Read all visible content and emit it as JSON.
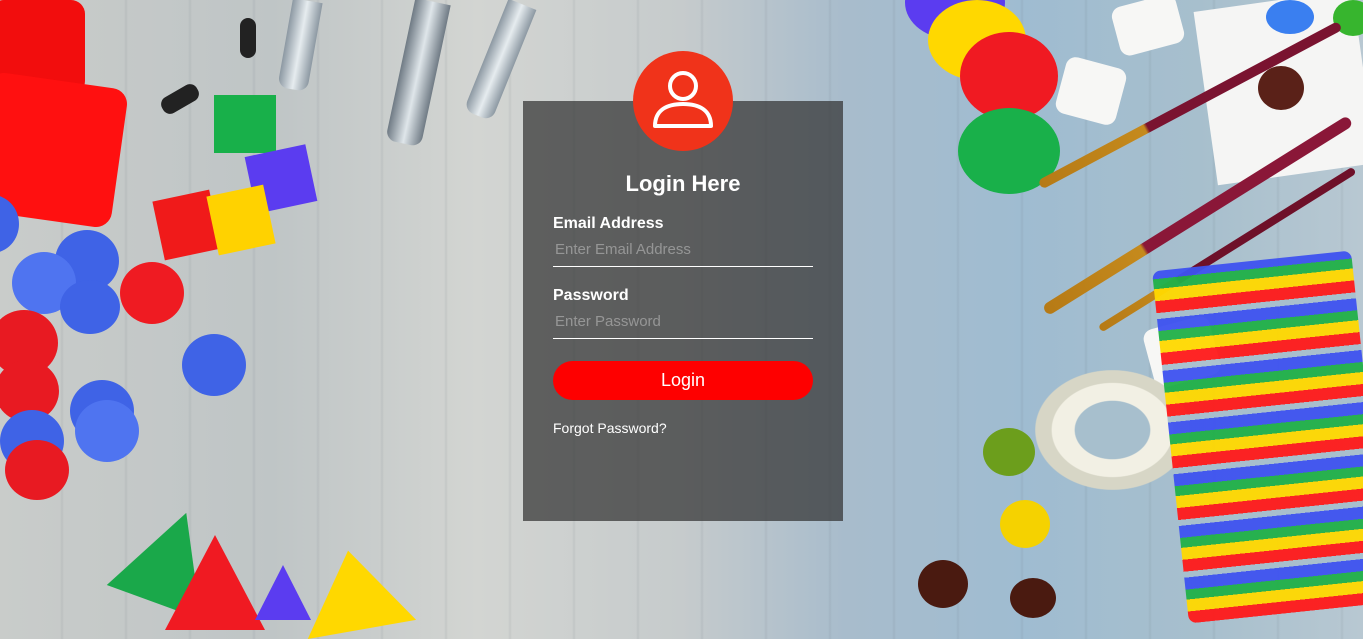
{
  "login": {
    "title": "Login Here",
    "email_label": "Email Address",
    "email_placeholder": "Enter Email Address",
    "password_label": "Password",
    "password_placeholder": "Enter Password",
    "submit_label": "Login",
    "forgot_label": "Forgot Password?"
  },
  "colors": {
    "accent": "#fe0000",
    "avatar_bg": "#f0331a",
    "card_bg": "rgba(50,50,50,0.72)"
  },
  "icons": {
    "avatar": "user-icon"
  }
}
